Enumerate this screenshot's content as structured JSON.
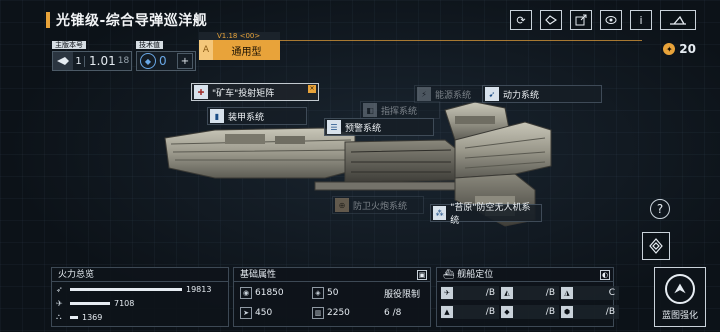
{
  "header": {
    "title": "光锥级-综合导弹巡洋舰",
    "icons": [
      "refresh-icon",
      "drone-icon",
      "export-icon",
      "view-icon",
      "info-icon",
      "fleet-icon"
    ],
    "info_glyph": "i",
    "refresh_glyph": "⟳"
  },
  "version": {
    "label": "主版本号",
    "index": "1",
    "value": "1.01",
    "sub": "18"
  },
  "tech": {
    "label": "技术值",
    "value": "0",
    "add_glyph": "+"
  },
  "type": {
    "label": "V1.18 <00>",
    "mark": "A",
    "value": "通用型"
  },
  "currency": {
    "value": "20",
    "icon": "coin-icon"
  },
  "modules": [
    {
      "id": "kuangche",
      "label": "\"矿车\"投射矩阵",
      "icon": "weapon-icon",
      "tone": "red",
      "state": "highlight"
    },
    {
      "id": "armor",
      "label": "装甲系统",
      "icon": "shield-icon",
      "tone": "blue",
      "state": "normal"
    },
    {
      "id": "command",
      "label": "指挥系统",
      "icon": "command-icon",
      "tone": "gray",
      "state": "dim"
    },
    {
      "id": "energy",
      "label": "能源系统",
      "icon": "energy-icon",
      "tone": "gray",
      "state": "dim"
    },
    {
      "id": "power",
      "label": "动力系统",
      "icon": "engine-icon",
      "tone": "blue",
      "state": "normal"
    },
    {
      "id": "warning",
      "label": "预警系统",
      "icon": "radar-icon",
      "tone": "blue",
      "state": "normal"
    },
    {
      "id": "defense",
      "label": "防卫火炮系统",
      "icon": "cannon-icon",
      "tone": "orange",
      "state": "dim"
    },
    {
      "id": "drone",
      "label": "\"苔原\"防空无人机系统",
      "icon": "drone-icon",
      "tone": "blue",
      "state": "normal"
    }
  ],
  "help_glyph": "?",
  "firepower": {
    "title": "火力总览",
    "rows": [
      {
        "icon": "missile-icon",
        "value": "19813",
        "ratio": 1.0
      },
      {
        "icon": "antiair-icon",
        "value": "7108",
        "ratio": 0.36
      },
      {
        "icon": "siege-icon",
        "value": "1369",
        "ratio": 0.07
      }
    ]
  },
  "attributes": {
    "title": "基础属性",
    "hp": "61850",
    "armor": "50",
    "service_label": "服役限制",
    "speed": "450",
    "cost": "2250",
    "service_value": "6 /8"
  },
  "positioning": {
    "title": "舰船定位",
    "cells": [
      {
        "icon": "fighter-icon",
        "grade": "/B"
      },
      {
        "icon": "corvette-icon",
        "grade": "/B"
      },
      {
        "icon": "frigate-icon",
        "grade": "C"
      },
      {
        "icon": "destroyer-icon",
        "grade": "/B"
      },
      {
        "icon": "cruiser-icon",
        "grade": "/B"
      },
      {
        "icon": "battlecruiser-icon",
        "grade": "/B"
      }
    ]
  },
  "upgrade": {
    "label": "蓝图强化",
    "glyph": "⮝"
  }
}
